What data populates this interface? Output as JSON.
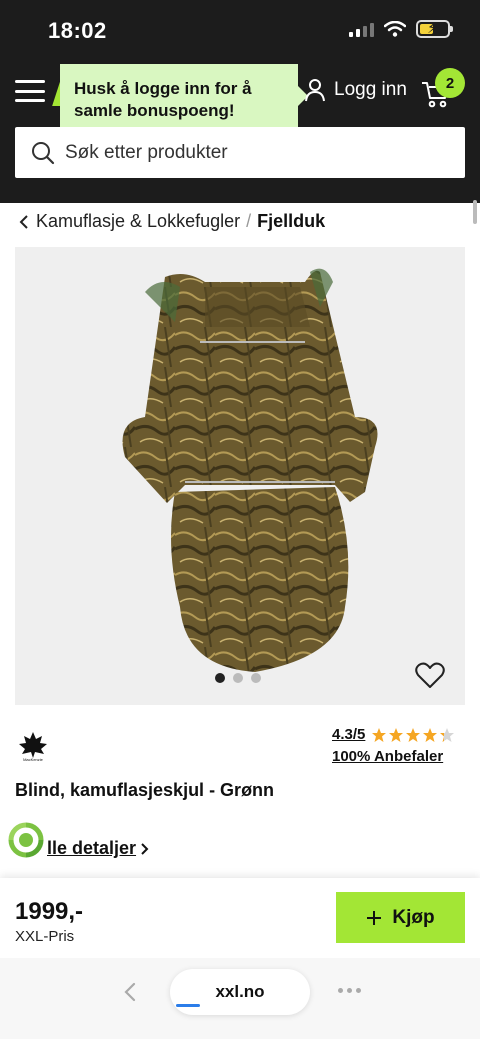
{
  "status_bar": {
    "time": "18:02",
    "battery_level": 0.5,
    "battery_color": "#f3d13a"
  },
  "header": {
    "tooltip": "Husk å logge inn for å samle bonuspoeng!",
    "login_label": "Logg inn",
    "cart_count": "2",
    "accent_color": "#a3e635"
  },
  "search": {
    "placeholder": "Søk etter produkter"
  },
  "breadcrumb": {
    "parent": "Kamuflasje & Lokkefugler",
    "separator": "/",
    "current": "Fjellduk"
  },
  "gallery": {
    "image_count": 3,
    "active_index": 0
  },
  "brand": {
    "logo_icon": "mackenzie-logo",
    "logo_text": "MacKenzie"
  },
  "rating": {
    "value": "4.3/5",
    "stars": 4.3,
    "recommend": "100% Anbefaler"
  },
  "product": {
    "title": "Blind, kamuflasjeskjul - Grønn"
  },
  "details": {
    "label": "lle detaljer"
  },
  "price_bar": {
    "price": "1999,-",
    "price_label": "XXL-Pris",
    "buy_label": "Kjøp"
  },
  "browser": {
    "url": "xxl.no"
  }
}
